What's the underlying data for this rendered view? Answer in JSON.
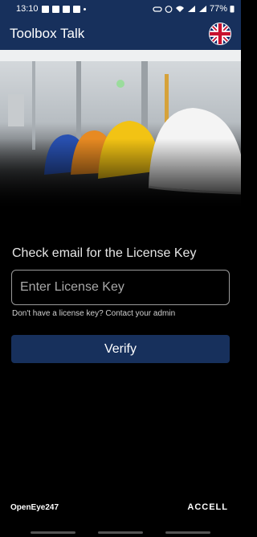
{
  "status_bar": {
    "time": "13:10",
    "battery": "77%"
  },
  "app_bar": {
    "title": "Toolbox Talk"
  },
  "main": {
    "heading": "Check email for the License Key",
    "license_input": {
      "placeholder": "Enter License Key",
      "value": ""
    },
    "helper_text": "Don't have a license key? Contact your admin",
    "verify_label": "Verify"
  },
  "footer": {
    "left_brand": "OpenEye247",
    "right_brand": "ACCELL"
  },
  "colors": {
    "primary": "#17305c",
    "background": "#000000"
  },
  "icons": [
    "uk-flag-icon",
    "wifi-icon",
    "signal-icon",
    "battery-icon",
    "alarm-icon"
  ]
}
